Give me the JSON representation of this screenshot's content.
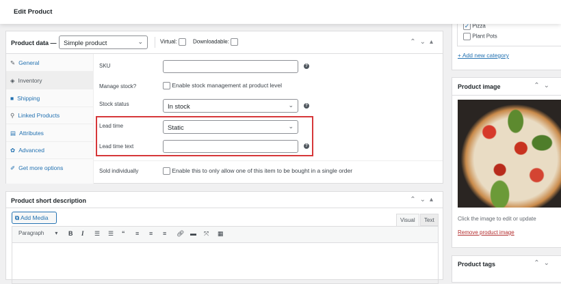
{
  "header": {
    "title": "Edit Product"
  },
  "product_data": {
    "title": "Product data —",
    "type": "Simple product",
    "virtual_label": "Virtual:",
    "downloadable_label": "Downloadable:",
    "tabs": [
      {
        "icon": "wrench-icon",
        "glyph": "✎",
        "label": "General"
      },
      {
        "icon": "inventory-icon",
        "glyph": "◈",
        "label": "Inventory"
      },
      {
        "icon": "truck-icon",
        "glyph": "■",
        "label": "Shipping"
      },
      {
        "icon": "link-icon",
        "glyph": "⚲",
        "label": "Linked Products"
      },
      {
        "icon": "table-icon",
        "glyph": "▤",
        "label": "Attributes"
      },
      {
        "icon": "gear-icon",
        "glyph": "✿",
        "label": "Advanced"
      },
      {
        "icon": "plugin-icon",
        "glyph": "✐",
        "label": "Get more options"
      }
    ],
    "fields": {
      "sku": "SKU",
      "manage_stock": "Manage stock?",
      "manage_stock_text": "Enable stock management at product level",
      "stock_status": "Stock status",
      "stock_status_value": "In stock",
      "lead_time": "Lead time",
      "lead_time_value": "Static",
      "lead_time_text": "Lead time text",
      "sold_individually": "Sold individually",
      "sold_individually_text": "Enable this to only allow one of this item to be bought in a single order"
    },
    "highlight_color": "#d63638"
  },
  "short_description": {
    "title": "Product short description",
    "add_media": "Add Media",
    "tab_visual": "Visual",
    "tab_text": "Text",
    "format": "Paragraph"
  },
  "categories": {
    "items": [
      {
        "label": "Pizza",
        "checked": true
      },
      {
        "label": "Plant Pots",
        "checked": false
      }
    ],
    "add_new": "+ Add new category"
  },
  "product_image": {
    "title": "Product image",
    "hint": "Click the image to edit or update",
    "remove": "Remove product image"
  },
  "product_tags": {
    "title": "Product tags"
  }
}
